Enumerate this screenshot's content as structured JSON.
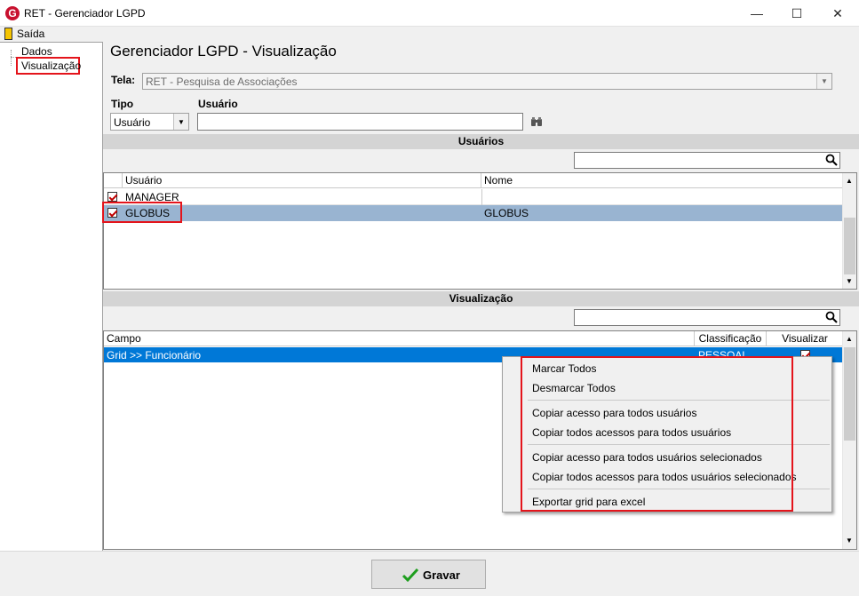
{
  "window": {
    "title": "RET - Gerenciador LGPD",
    "app_icon_letter": "G",
    "minimize_glyph": "—",
    "maximize_glyph": "☐",
    "close_glyph": "✕"
  },
  "menubar": {
    "exit_label": "Saída"
  },
  "sidebar": {
    "items": [
      {
        "label": "Dados"
      },
      {
        "label": "Visualização",
        "selected": true
      }
    ]
  },
  "main": {
    "heading": "Gerenciador LGPD - Visualização",
    "tela_label": "Tela:",
    "tela_value": "RET - Pesquisa de Associações",
    "tipo_label": "Tipo",
    "tipo_value": "Usuário",
    "usuario_label": "Usuário",
    "usuario_value": ""
  },
  "usuarios_section": {
    "title": "Usuários",
    "search_value": "",
    "columns": [
      "Usuário",
      "Nome"
    ],
    "rows": [
      {
        "usuario": "MANAGER",
        "nome": "",
        "checked": true,
        "selected": false
      },
      {
        "usuario": "GLOBUS",
        "nome": "GLOBUS",
        "checked": true,
        "selected": true
      }
    ]
  },
  "visualizacao_section": {
    "title": "Visualização",
    "search_value": "",
    "columns": [
      "Campo",
      "Classificação",
      "Visualizar"
    ],
    "rows": [
      {
        "campo": "Grid >> Funcionário",
        "classificacao": "PESSOAL",
        "visualizar": true
      }
    ]
  },
  "context_menu": {
    "items": [
      "Marcar Todos",
      "Desmarcar Todos",
      "Copiar acesso para todos usuários",
      "Copiar todos acessos para todos usuários",
      "Copiar acesso para todos usuários selecionados",
      "Copiar todos acessos para todos usuários selecionados",
      "Exportar grid para excel"
    ]
  },
  "footer": {
    "save_label": "Gravar"
  },
  "colors": {
    "selection": "#99b4d1",
    "selection_dark": "#0078d7",
    "highlight_box": "#e4141b",
    "check": "#c00000",
    "save_icon": "#1e9e1e"
  }
}
